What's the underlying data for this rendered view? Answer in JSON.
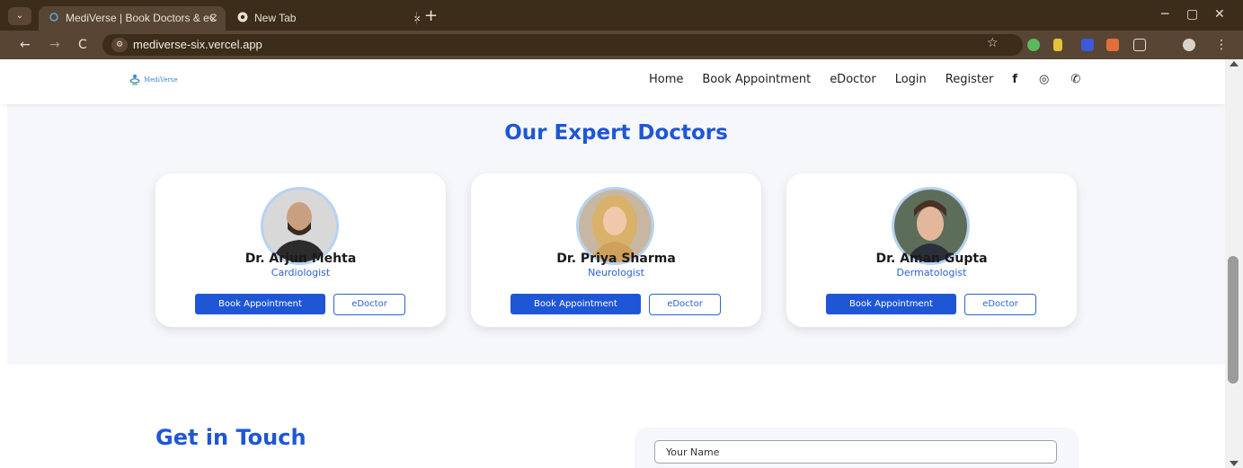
{
  "browser": {
    "tabs": [
      {
        "title": "MediVerse | Book Doctors & eC",
        "active": true
      },
      {
        "title": "New Tab",
        "active": false
      }
    ],
    "url": "mediverse-six.vercel.app",
    "icons": {
      "back": "←",
      "forward": "→",
      "reload": "C",
      "star": "☆",
      "tab_menu": "⌄",
      "close": "×",
      "new_tab": "+",
      "minimize": "─",
      "restore": "▢",
      "window_close": "✕"
    }
  },
  "header": {
    "logo_text": "MediVerse",
    "nav": [
      "Home",
      "Book Appointment",
      "eDoctor",
      "Login",
      "Register"
    ],
    "social": [
      {
        "name": "facebook-icon",
        "glyph": "f"
      },
      {
        "name": "instagram-icon",
        "glyph": "◎"
      },
      {
        "name": "whatsapp-icon",
        "glyph": "✆"
      }
    ]
  },
  "doctors": {
    "title": "Our Expert Doctors",
    "cards": [
      {
        "name": "Dr. Arjun Mehta",
        "specialty": "Cardiologist",
        "book_label": "Book Appointment",
        "edoctor_label": "eDoctor"
      },
      {
        "name": "Dr. Priya Sharma",
        "specialty": "Neurologist",
        "book_label": "Book Appointment",
        "edoctor_label": "eDoctor"
      },
      {
        "name": "Dr. Aman Gupta",
        "specialty": "Dermatologist",
        "book_label": "Book Appointment",
        "edoctor_label": "eDoctor"
      }
    ]
  },
  "contact": {
    "title": "Get in Touch",
    "name_placeholder": "Your Name"
  },
  "colors": {
    "accent": "#1f56d6",
    "chrome_dark": "#3c2c1a",
    "chrome_mid": "#584533"
  }
}
